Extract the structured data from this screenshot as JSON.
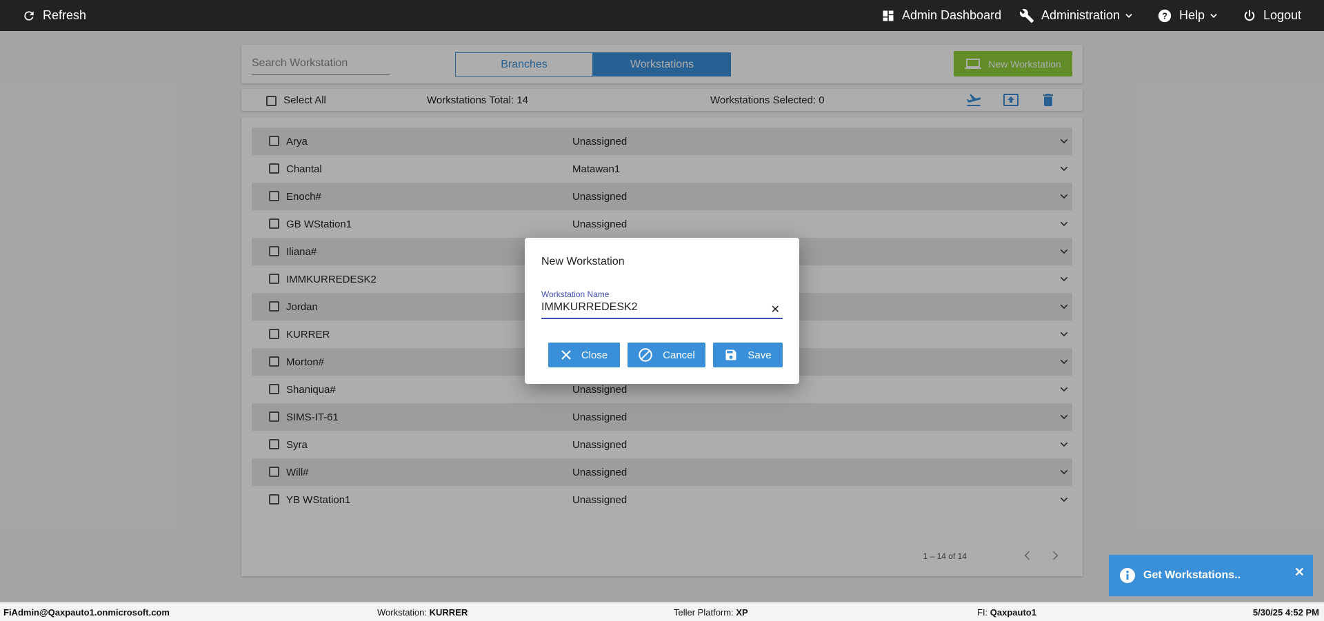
{
  "topbar": {
    "refresh": "Refresh",
    "admin_dashboard": "Admin Dashboard",
    "administration": "Administration",
    "help": "Help",
    "logout": "Logout"
  },
  "header": {
    "search_placeholder": "Search Workstation",
    "tabs": [
      "Branches",
      "Workstations"
    ],
    "active_tab": "Workstations",
    "new_button": "New Workstation"
  },
  "toolbar": {
    "select_all": "Select All",
    "total": "Workstations Total: 14",
    "selected": "Workstations Selected: 0"
  },
  "rows": [
    {
      "name": "Arya",
      "branch": "Unassigned"
    },
    {
      "name": "Chantal",
      "branch": "Matawan1"
    },
    {
      "name": "Enoch#",
      "branch": "Unassigned"
    },
    {
      "name": "GB WStation1",
      "branch": "Unassigned"
    },
    {
      "name": "Iliana#",
      "branch": ""
    },
    {
      "name": "IMMKURREDESK2",
      "branch": ""
    },
    {
      "name": "Jordan",
      "branch": ""
    },
    {
      "name": "KURRER",
      "branch": ""
    },
    {
      "name": "Morton#",
      "branch": ""
    },
    {
      "name": "Shaniqua#",
      "branch": "Unassigned"
    },
    {
      "name": "SIMS-IT-61",
      "branch": "Unassigned"
    },
    {
      "name": "Syra",
      "branch": "Unassigned"
    },
    {
      "name": "Will#",
      "branch": "Unassigned"
    },
    {
      "name": "YB WStation1",
      "branch": "Unassigned"
    }
  ],
  "pager": {
    "range": "1 – 14 of 14"
  },
  "dialog": {
    "title": "New Workstation",
    "field_label": "Workstation Name",
    "field_value": "IMMKURREDESK2",
    "close": "Close",
    "cancel": "Cancel",
    "save": "Save"
  },
  "status": {
    "user": "FiAdmin@Qaxpauto1.onmicrosoft.com",
    "workstation_label": "Workstation:",
    "workstation": "KURRER",
    "platform_label": "Teller Platform:",
    "platform": "XP",
    "fi_label": "FI:",
    "fi": "Qaxpauto1",
    "datetime": "5/30/25 4:52 PM"
  },
  "toast": {
    "message": "Get Workstations.."
  },
  "colors": {
    "accent": "#3a8fd9",
    "green": "#8fcf3c",
    "topbar": "#222222",
    "dialog_accent": "#3f51b5"
  }
}
